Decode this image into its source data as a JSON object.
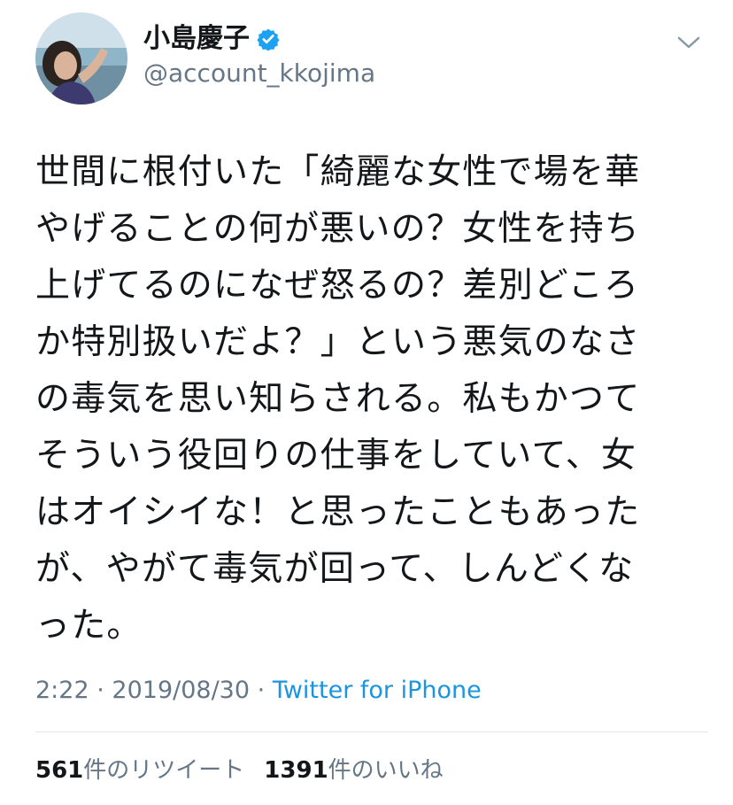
{
  "author": {
    "display_name": "小島慶子",
    "handle": "@account_kkojima",
    "verified": true
  },
  "tweet": {
    "text": "世間に根付いた「綺麗な女性で場を華\nやげることの何が悪いの？女性を持ち\n上げてるのになぜ怒るの？差別どころ\nか特別扱いだよ？」という悪気のなさ\nの毒気を思い知らされる。私もかつて\nそういう役回りの仕事をしていて、女\nはオイシイな！と思ったこともあった\nが、やがて毒気が回って、しんどくな\nった。",
    "time": "2:22",
    "separator": "·",
    "date": "2019/08/30",
    "source": "Twitter for iPhone"
  },
  "stats": {
    "retweets": {
      "count": "561",
      "label": "件のリツイート"
    },
    "likes": {
      "count": "1391",
      "label": "件のいいね"
    }
  },
  "colors": {
    "text": "#14171a",
    "secondary": "#657786",
    "link": "#1b95e0",
    "verified": "#1da1f2",
    "divider": "#e1e8ed"
  },
  "icons": {
    "verified": "verified-badge-icon",
    "caret": "chevron-down-icon"
  }
}
